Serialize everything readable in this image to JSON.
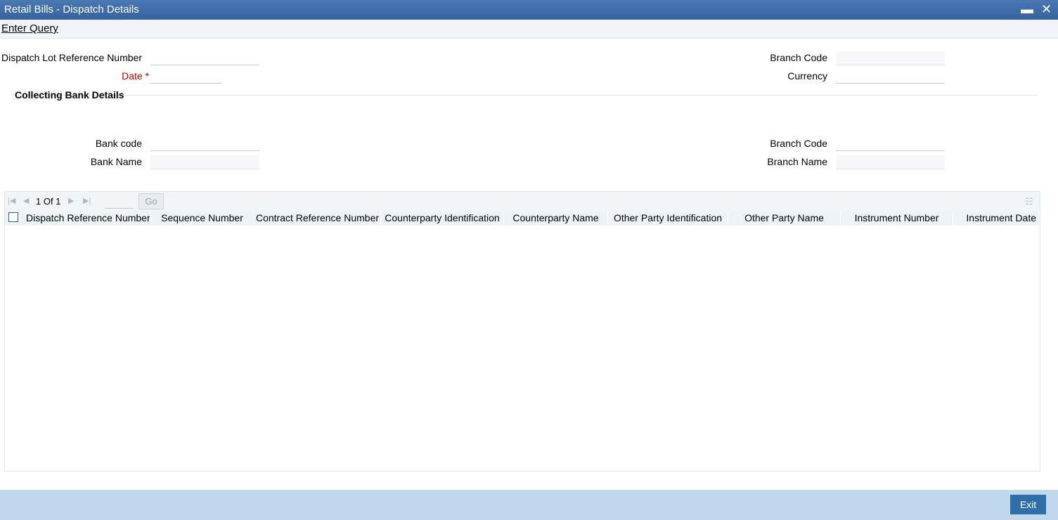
{
  "window": {
    "title": "Retail Bills - Dispatch Details",
    "minimize_glyph": "▬",
    "close_glyph": "✕"
  },
  "menu": {
    "enter_query": "Enter Query"
  },
  "form": {
    "dispatch_lot_reference_number": {
      "label": "Dispatch Lot Reference Number",
      "value": ""
    },
    "date": {
      "label": "Date",
      "required_mark": "*",
      "value": ""
    },
    "branch_code": {
      "label": "Branch Code",
      "value": ""
    },
    "currency": {
      "label": "Currency",
      "value": ""
    }
  },
  "collecting_bank": {
    "section_title": "Collecting Bank Details",
    "bank_code": {
      "label": "Bank code",
      "value": ""
    },
    "bank_name": {
      "label": "Bank Name",
      "value": ""
    },
    "branch_code": {
      "label": "Branch Code",
      "value": ""
    },
    "branch_name": {
      "label": "Branch Name",
      "value": ""
    }
  },
  "grid": {
    "pager": {
      "current": "1",
      "of_label": "Of",
      "total": "1",
      "text": "1 Of 1",
      "go_label": "Go"
    },
    "columns": [
      "Dispatch Reference Number",
      "Sequence Number",
      "Contract Reference Number",
      "Counterparty Identification",
      "Counterparty Name",
      "Other Party Identification",
      "Other Party Name",
      "Instrument Number",
      "Instrument Date"
    ],
    "rows": []
  },
  "footer": {
    "exit_label": "Exit"
  },
  "icons": {
    "first_page": "first-page-icon",
    "prev_page": "prev-page-icon",
    "next_page": "next-page-icon",
    "last_page": "last-page-icon",
    "grid_settings": "grid-settings-icon"
  },
  "colors": {
    "title_bar": "#36639f",
    "footer": "#bfd8ee",
    "exit_button": "#2f6ea8",
    "required": "#c00000"
  }
}
